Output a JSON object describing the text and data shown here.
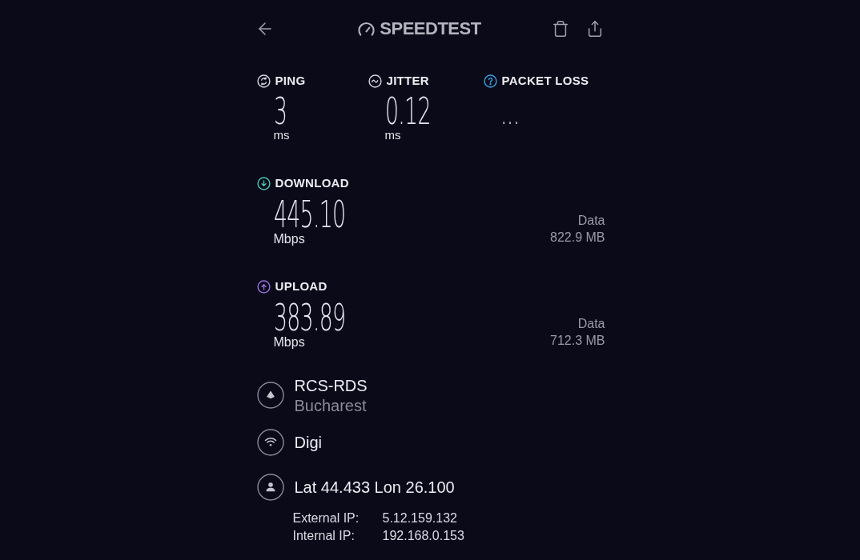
{
  "header": {
    "title": "SPEEDTEST"
  },
  "metrics": [
    {
      "kind": "ping",
      "label": "PING",
      "value": "3",
      "unit": "ms",
      "color": "#d4d4dc"
    },
    {
      "kind": "jitter",
      "label": "JITTER",
      "value": "0.12",
      "unit": "ms",
      "color": "#d4d4dc"
    },
    {
      "kind": "packet_loss",
      "label": "PACKET LOSS",
      "value": "...",
      "color": "#3d9fe0"
    }
  ],
  "speeds": [
    {
      "kind": "download",
      "label": "DOWNLOAD",
      "value": "445.10",
      "unit": "Mbps",
      "data_label": "Data",
      "data_value": "822.9 MB",
      "color": "#4fc2b4"
    },
    {
      "kind": "upload",
      "label": "UPLOAD",
      "value": "383.89",
      "unit": "Mbps",
      "data_label": "Data",
      "data_value": "712.3 MB",
      "color": "#9a6ed8"
    }
  ],
  "connection": [
    {
      "kind": "server",
      "title": "RCS-RDS",
      "subtitle": "Bucharest"
    },
    {
      "kind": "network",
      "title": "Digi"
    },
    {
      "kind": "location",
      "title": "Lat 44.433 Lon 26.100"
    }
  ],
  "ip_addresses": [
    {
      "label": "External IP:",
      "value": "5.12.159.132"
    },
    {
      "label": "Internal IP:",
      "value": "192.168.0.153"
    }
  ]
}
